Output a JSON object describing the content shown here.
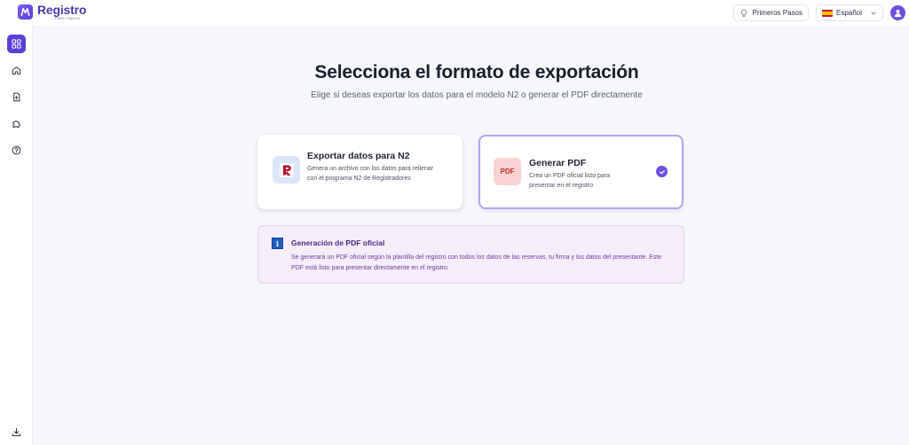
{
  "app": {
    "name": "Registro",
    "tagline": "Parte Viajeros"
  },
  "header": {
    "steps_label": "Primeros Pasos",
    "language_label": "Español"
  },
  "sidebar": {
    "items": [
      {
        "icon": "grid-icon",
        "active": true
      },
      {
        "icon": "home-icon",
        "active": false
      },
      {
        "icon": "document-upload-icon",
        "active": false
      },
      {
        "icon": "puzzle-icon",
        "active": false
      },
      {
        "icon": "help-icon",
        "active": false
      },
      {
        "icon": "download-icon",
        "active": false
      }
    ]
  },
  "main": {
    "title": "Selecciona el formato de exportación",
    "subtitle": "Elige si deseas exportar los datos para el modelo N2 o generar el PDF directamente",
    "options": {
      "n2": {
        "title": "Exportar datos para N2",
        "description": "Genera un archivo con los datos para rellenar con el programa N2 de Registradores",
        "selected": false
      },
      "pdf": {
        "icon_label": "PDF",
        "title": "Generar PDF",
        "description": "Crea un PDF oficial listo para presentar en el registro",
        "selected": true
      }
    },
    "info": {
      "icon_label": "i",
      "title": "Generación de PDF oficial",
      "text": "Se generará un PDF oficial según la plantilla del registro con todos los datos de las reservas, tu firma y los datos del presentante. Este PDF está listo para presentar directamente en el registro."
    }
  },
  "colors": {
    "accent": "#5b3fd6",
    "selected_border": "#b3a4ec",
    "info_bg": "#f5edf9",
    "info_text": "#6b3e9a",
    "pdf_icon_bg": "#f9d3d3",
    "n2_icon_bg": "#dbe6f8"
  }
}
